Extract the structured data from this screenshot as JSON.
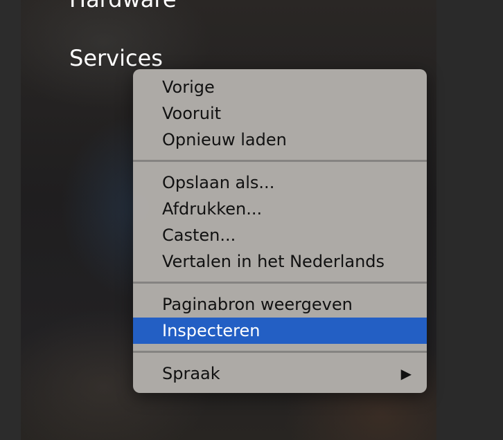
{
  "background": {
    "headings": {
      "hardware": "Hardware",
      "services": "Services"
    }
  },
  "context_menu": {
    "groups": [
      {
        "items": [
          {
            "label": "Vorige"
          },
          {
            "label": "Vooruit"
          },
          {
            "label": "Opnieuw laden"
          }
        ]
      },
      {
        "items": [
          {
            "label": "Opslaan als..."
          },
          {
            "label": "Afdrukken..."
          },
          {
            "label": "Casten..."
          },
          {
            "label": "Vertalen in het Nederlands"
          }
        ]
      },
      {
        "items": [
          {
            "label": "Paginabron weergeven"
          },
          {
            "label": "Inspecteren",
            "highlighted": true
          }
        ]
      },
      {
        "items": [
          {
            "label": "Spraak",
            "submenu": true
          }
        ]
      }
    ],
    "submenu_arrow_icon": "triangle-right-icon",
    "highlight_color": "#235fc4"
  }
}
